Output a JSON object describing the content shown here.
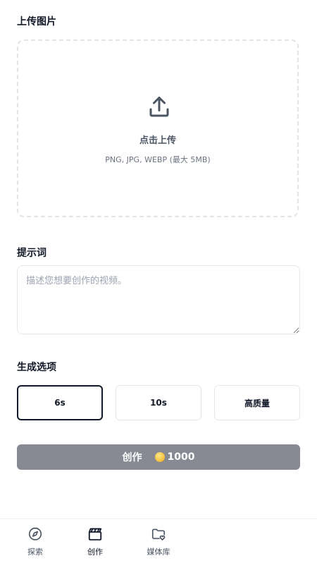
{
  "upload": {
    "title": "上传图片",
    "main_text": "点击上传",
    "sub_text": "PNG, JPG, WEBP (最大 5MB)",
    "icon": "upload-icon"
  },
  "prompt": {
    "title": "提示词",
    "placeholder": "描述您想要创作的视频。"
  },
  "options": {
    "title": "生成选项",
    "items": [
      {
        "label": "6s",
        "selected": true
      },
      {
        "label": "10s",
        "selected": false
      },
      {
        "label": "高质量",
        "selected": false
      }
    ]
  },
  "create_button": {
    "label": "创作",
    "cost": "1000",
    "icon": "coin-icon"
  },
  "bottom_nav": [
    {
      "label": "探索",
      "icon": "compass-icon",
      "active": false
    },
    {
      "label": "创作",
      "icon": "clapperboard-icon",
      "active": true
    },
    {
      "label": "媒体库",
      "icon": "folder-heart-icon",
      "active": false
    }
  ],
  "colors": {
    "button_bg": "#878a92",
    "selected_border": "#111827",
    "coin": "#f5c542"
  }
}
